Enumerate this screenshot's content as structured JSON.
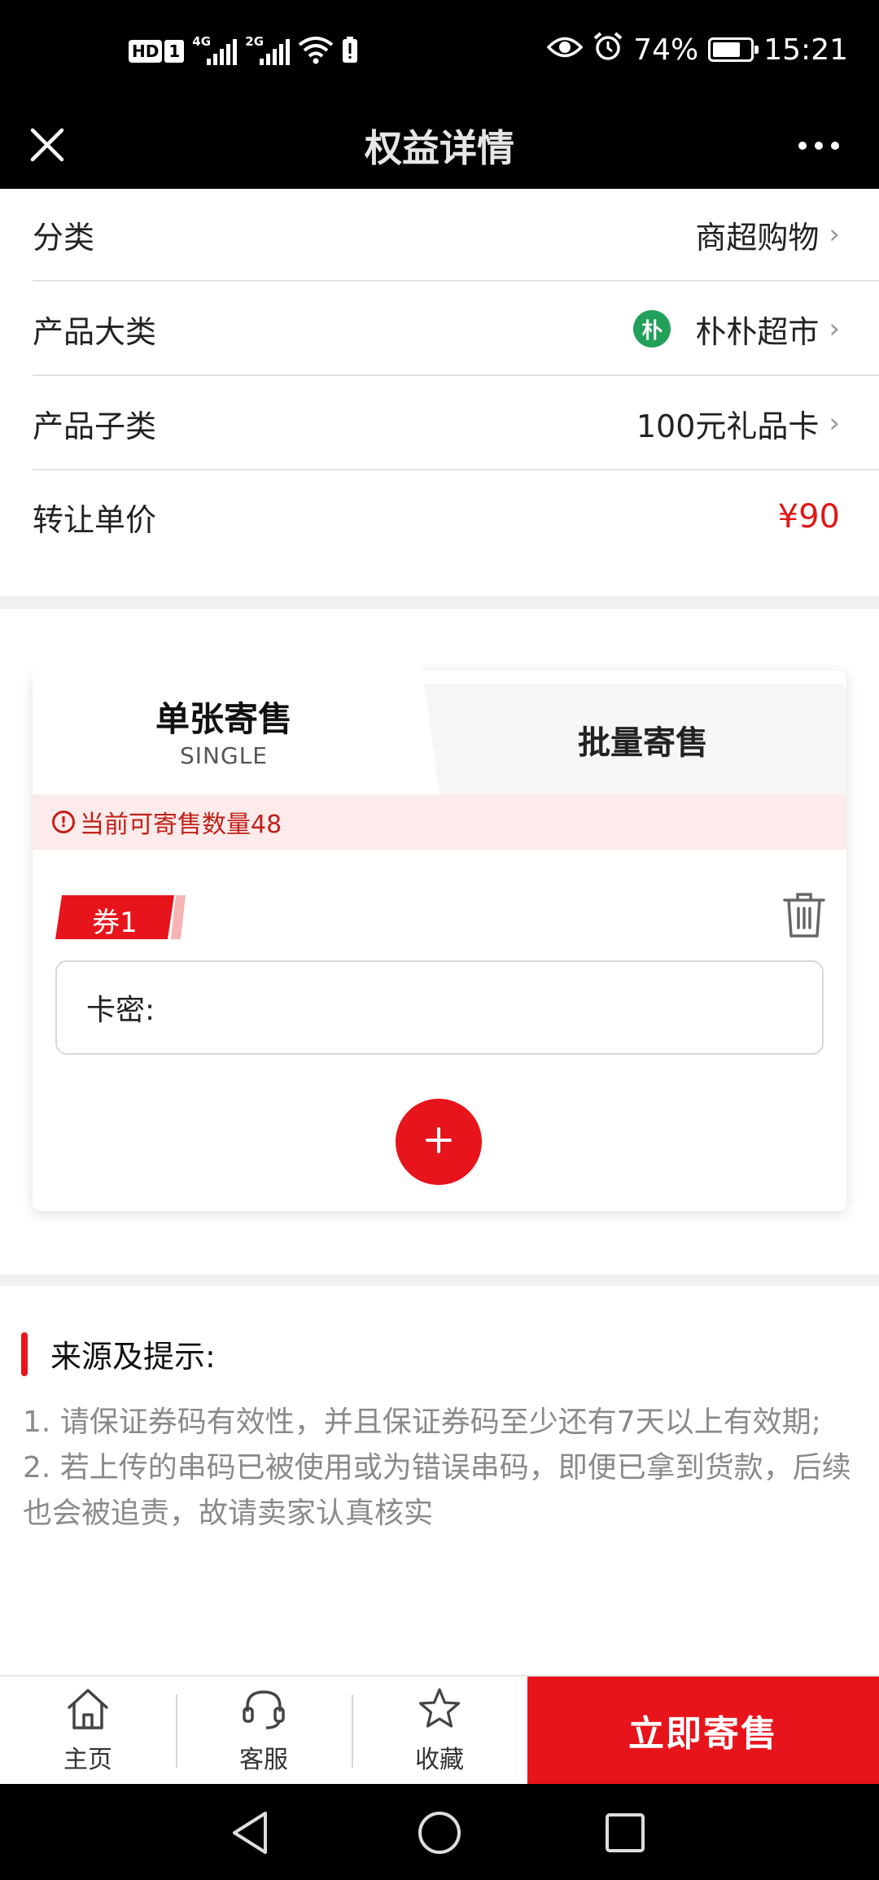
{
  "status_bar": {
    "hd_label": "HD",
    "sim_label": "1",
    "signal1_type": "4G",
    "signal2_type": "2G",
    "battery_percent": "74%",
    "battery_level": 0.74,
    "time": "15:21"
  },
  "nav": {
    "title": "权益详情"
  },
  "info": {
    "category_label": "分类",
    "category_value": "商超购物",
    "product_type_label": "产品大类",
    "product_type_logo_text": "朴",
    "product_type_value": "朴朴超市",
    "product_sub_label": "产品子类",
    "product_sub_value": "100元礼品卡",
    "unit_price_label": "转让单价",
    "unit_price_value": "¥90"
  },
  "tabs": {
    "single_title": "单张寄售",
    "single_sub": "SINGLE",
    "batch_title": "批量寄售"
  },
  "alert": {
    "icon_text": "!",
    "text": "当前可寄售数量48"
  },
  "coupon": {
    "tag": "券1",
    "code_label": "卡密:"
  },
  "tips": {
    "title": "来源及提示:",
    "line1": "1. 请保证券码有效性，并且保证券码至少还有7天以上有效期;",
    "line2": "2. 若上传的串码已被使用或为错误串码，即便已拿到货款，后续也会被追责，故请卖家认真核实"
  },
  "bottom_bar": {
    "home_label": "主页",
    "service_label": "客服",
    "favorite_label": "收藏",
    "sell_label": "立即寄售"
  },
  "colors": {
    "accent": "#e8141b",
    "price": "#e01818",
    "alert_bg": "#fcebea",
    "brand_green": "#22a05a"
  }
}
